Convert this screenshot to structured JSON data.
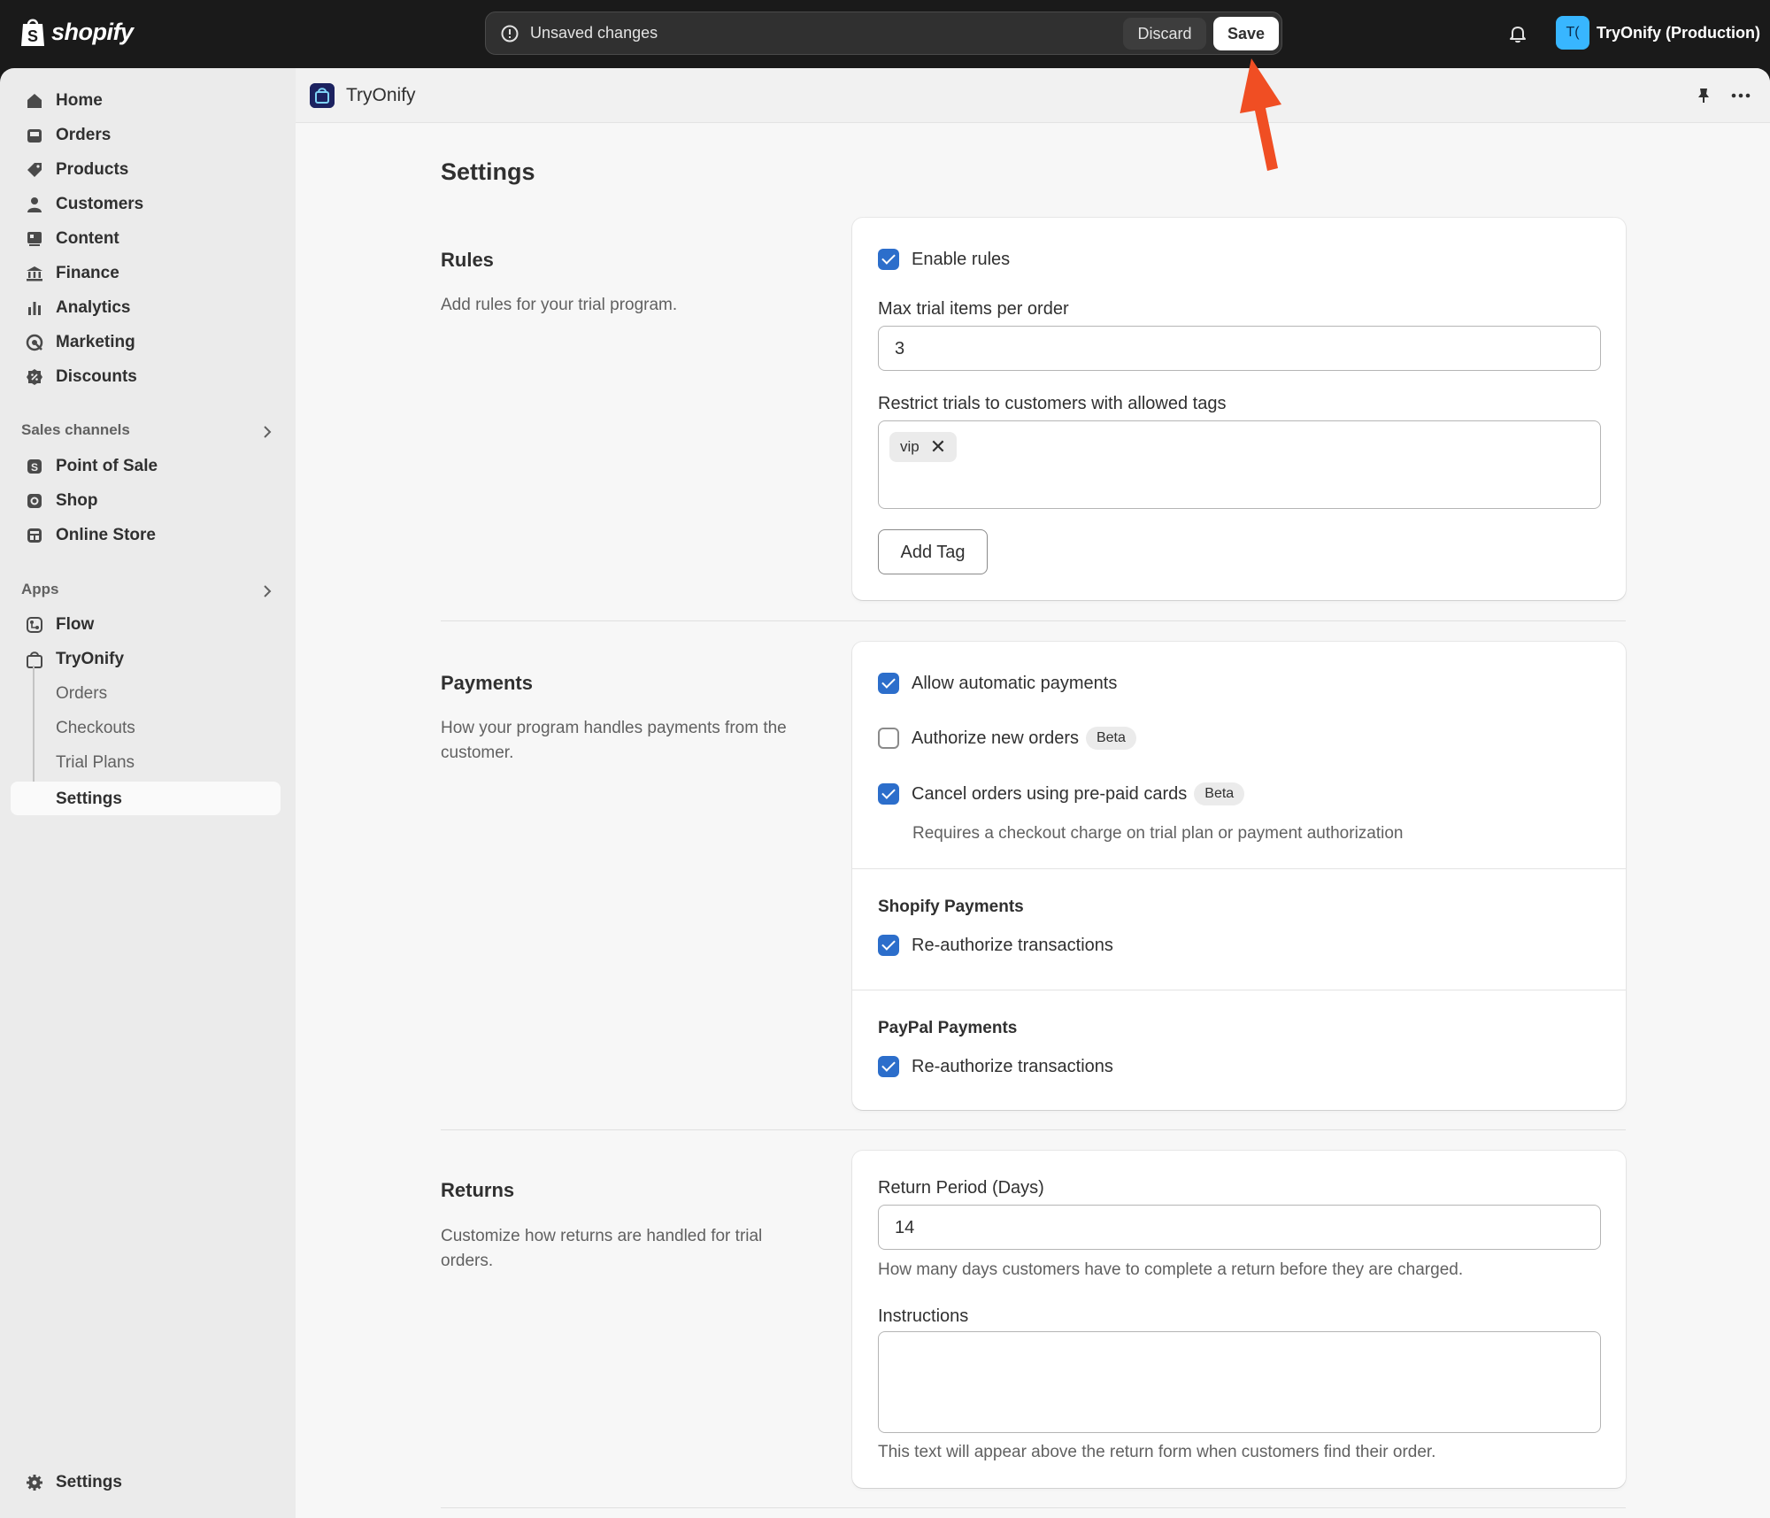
{
  "topbar": {
    "brand": "shopify",
    "unsaved_text": "Unsaved changes",
    "discard_label": "Discard",
    "save_label": "Save",
    "store_initials": "T(",
    "store_name": "TryOnify (Production)"
  },
  "sidebar": {
    "main_items": [
      {
        "label": "Home",
        "icon": "home-icon"
      },
      {
        "label": "Orders",
        "icon": "orders-icon"
      },
      {
        "label": "Products",
        "icon": "tag-icon"
      },
      {
        "label": "Customers",
        "icon": "person-icon"
      },
      {
        "label": "Content",
        "icon": "content-icon"
      },
      {
        "label": "Finance",
        "icon": "bank-icon"
      },
      {
        "label": "Analytics",
        "icon": "bar-chart-icon"
      },
      {
        "label": "Marketing",
        "icon": "target-icon"
      },
      {
        "label": "Discounts",
        "icon": "discount-icon"
      }
    ],
    "sales_channels_label": "Sales channels",
    "sales_channels": [
      {
        "label": "Point of Sale",
        "icon": "pos-icon"
      },
      {
        "label": "Shop",
        "icon": "shop-icon"
      },
      {
        "label": "Online Store",
        "icon": "store-icon"
      }
    ],
    "apps_label": "Apps",
    "apps": [
      {
        "label": "Flow",
        "icon": "flow-icon"
      },
      {
        "label": "TryOnify",
        "icon": "bag-icon"
      }
    ],
    "app_subitems": [
      "Orders",
      "Checkouts",
      "Trial Plans",
      "Settings"
    ],
    "settings_label": "Settings"
  },
  "appbar": {
    "title": "TryOnify"
  },
  "page": {
    "title": "Settings",
    "rules": {
      "title": "Rules",
      "description": "Add rules for your trial program.",
      "enable_rules_label": "Enable rules",
      "enable_rules_checked": true,
      "max_items_label": "Max trial items per order",
      "max_items_value": "3",
      "restrict_label": "Restrict trials to customers with allowed tags",
      "tags": [
        "vip"
      ],
      "add_tag_label": "Add Tag"
    },
    "payments": {
      "title": "Payments",
      "description": "How your program handles payments from the customer.",
      "allow_auto_label": "Allow automatic payments",
      "allow_auto_checked": true,
      "authorize_label": "Authorize new orders",
      "authorize_checked": false,
      "authorize_badge": "Beta",
      "cancel_label": "Cancel orders using pre-paid cards",
      "cancel_checked": true,
      "cancel_badge": "Beta",
      "cancel_help": "Requires a checkout charge on trial plan or payment authorization",
      "shopify_title": "Shopify Payments",
      "shopify_reauth_label": "Re-authorize transactions",
      "shopify_reauth_checked": true,
      "paypal_title": "PayPal Payments",
      "paypal_reauth_label": "Re-authorize transactions",
      "paypal_reauth_checked": true
    },
    "returns": {
      "title": "Returns",
      "description": "Customize how returns are handled for trial orders.",
      "period_label": "Return Period (Days)",
      "period_value": "14",
      "period_help": "How many days customers have to complete a return before they are charged.",
      "instructions_label": "Instructions",
      "instructions_value": "",
      "instructions_help": "This text will appear above the return form when customers find their order."
    }
  },
  "colors": {
    "checkbox_on": "#2c6ecb",
    "annotation_arrow": "#f04e23",
    "topbar_bg": "#1a1a1a"
  }
}
